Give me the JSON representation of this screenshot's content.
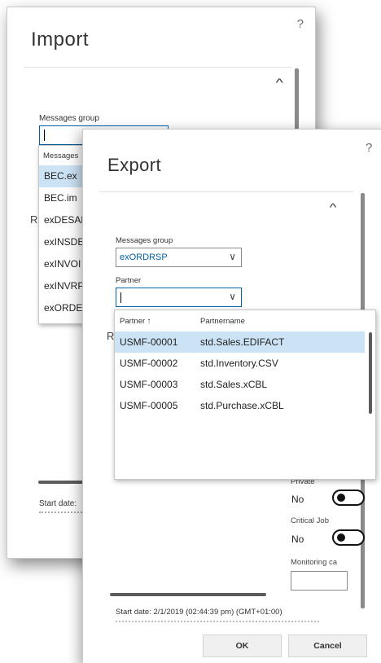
{
  "import_dialog": {
    "title": "Import",
    "help": "?",
    "collapse_icon": "chevron-up-icon",
    "messages_group_label": "Messages group",
    "messages_group_value": "",
    "section_stub": "R",
    "start_date_label": "Start date:",
    "dropdown": {
      "header": "Messages",
      "items": [
        "BEC.ex",
        "BEC.im",
        "exDESAD",
        "exINSDE",
        "exINVOI",
        "exINVRP",
        "exORDEI"
      ],
      "selected_index": 0
    }
  },
  "export_dialog": {
    "title": "Export",
    "help": "?",
    "collapse_icon": "chevron-up-icon",
    "messages_group_label": "Messages group",
    "messages_group_value": "exORDRSP",
    "partner_label": "Partner",
    "partner_value": "",
    "section_stub": "R",
    "private_label": "Private",
    "private_value": "No",
    "critical_label": "Critical Job",
    "critical_value": "No",
    "monitoring_label": "Monitoring ca",
    "start_date_text": "Start date: 2/1/2019 (02:44:39 pm) (GMT+01:00)",
    "ok_label": "OK",
    "cancel_label": "Cancel",
    "dropdown_icon": "chevron-down-icon",
    "partner_dropdown": {
      "columns": [
        "Partner ↑",
        "Partnername"
      ],
      "rows": [
        [
          "USMF-00001",
          "std.Sales.EDIFACT"
        ],
        [
          "USMF-00002",
          "std.Inventory.CSV"
        ],
        [
          "USMF-00003",
          "std.Sales.xCBL"
        ],
        [
          "USMF-00005",
          "std.Purchase.xCBL"
        ]
      ],
      "selected_index": 0
    }
  },
  "colors": {
    "accent": "#0062a8",
    "selection": "#cce3f5"
  }
}
